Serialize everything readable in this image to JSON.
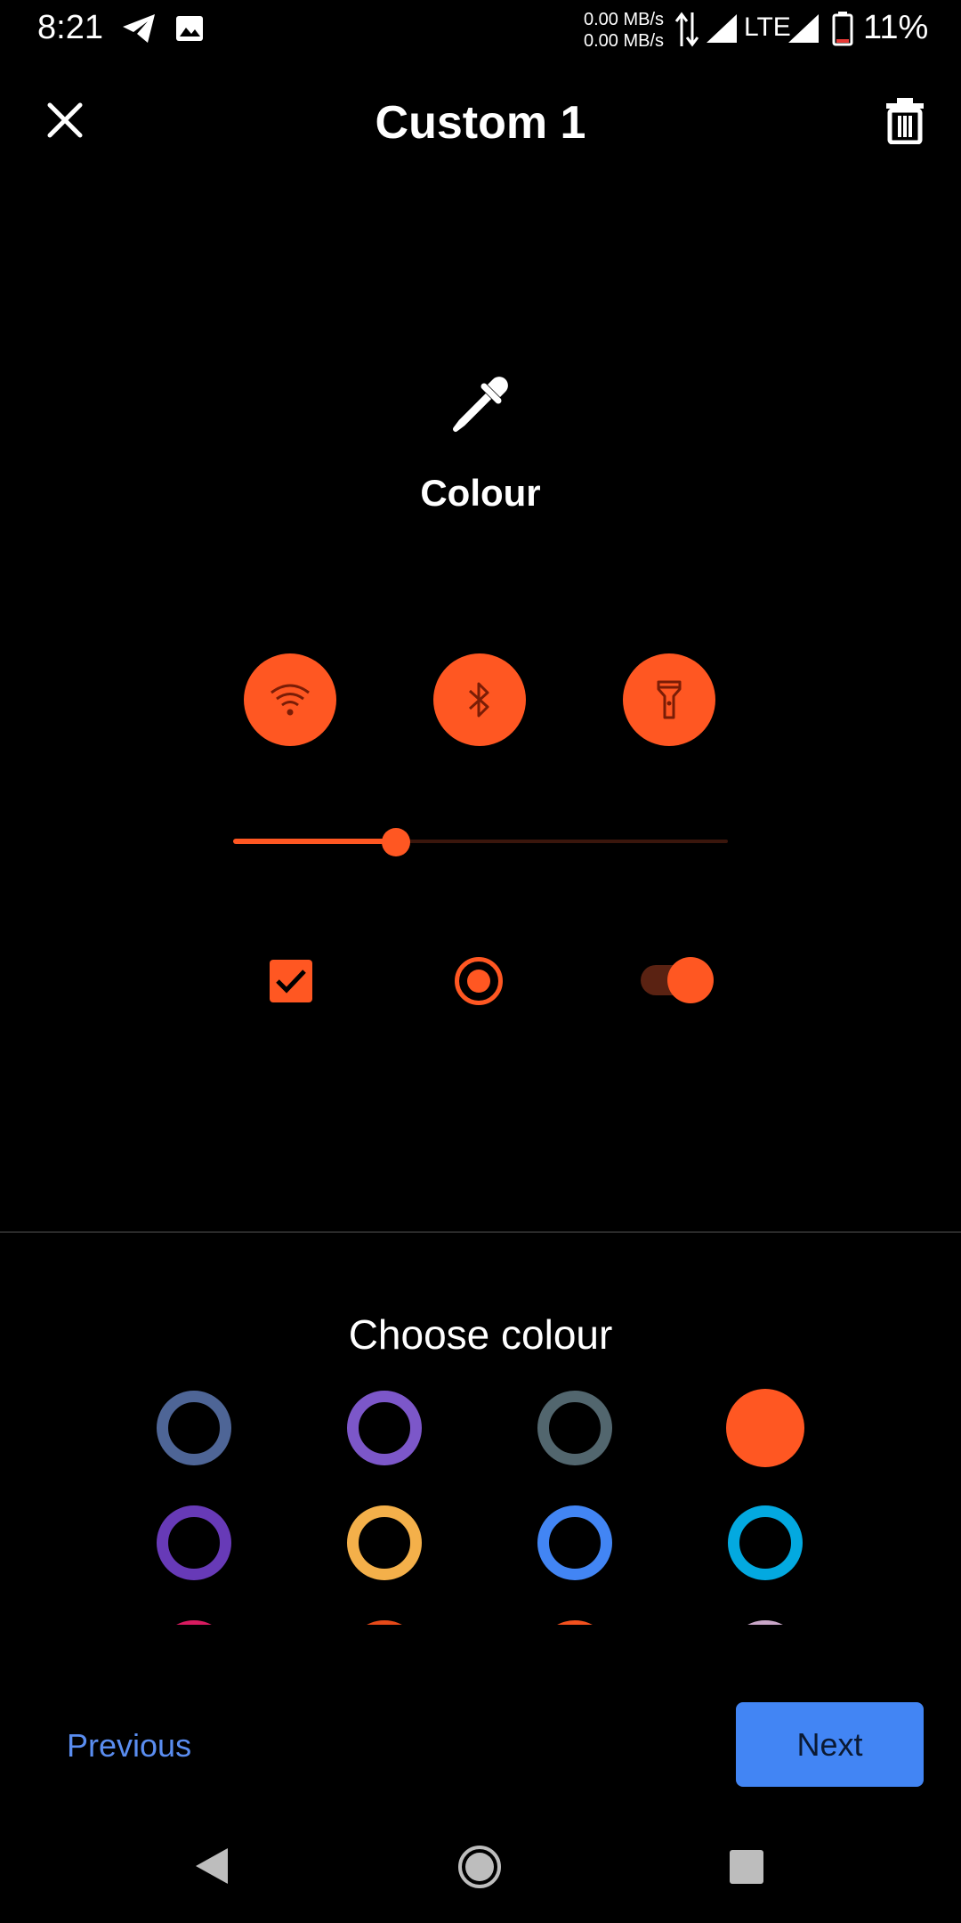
{
  "status_bar": {
    "time": "8:21",
    "net_up": "0.00 MB/s",
    "net_down": "0.00 MB/s",
    "network": "LTE",
    "battery": "11%"
  },
  "app_bar": {
    "title": "Custom 1",
    "close_icon": "close-icon",
    "delete_icon": "trash-icon"
  },
  "section": {
    "icon": "eyedropper-icon",
    "label": "Colour"
  },
  "preview": {
    "accent": "#ff5722",
    "buttons": [
      "wifi-icon",
      "bluetooth-icon",
      "flashlight-icon"
    ],
    "slider_value": 0.33,
    "checkbox_checked": true,
    "radio_selected": true,
    "switch_on": true
  },
  "chooser": {
    "title": "Choose colour",
    "swatches": [
      {
        "color": "#4e6596",
        "selected": false
      },
      {
        "color": "#7c57c9",
        "selected": false
      },
      {
        "color": "#52666e",
        "selected": false
      },
      {
        "color": "#ff5722",
        "selected": true
      },
      {
        "color": "#673ab7",
        "selected": false
      },
      {
        "color": "#f4b04a",
        "selected": false
      },
      {
        "color": "#4285f4",
        "selected": false
      },
      {
        "color": "#03a9e0",
        "selected": false
      },
      {
        "color": "#d81b60",
        "selected": false
      },
      {
        "color": "#e64a19",
        "selected": false
      },
      {
        "color": "#f4511e",
        "selected": false
      },
      {
        "color": "#c9a6c8",
        "selected": false
      }
    ]
  },
  "footer": {
    "previous_label": "Previous",
    "next_label": "Next"
  },
  "nav_bar": {
    "back": "back-icon",
    "home": "home-icon",
    "recents": "recents-icon"
  }
}
